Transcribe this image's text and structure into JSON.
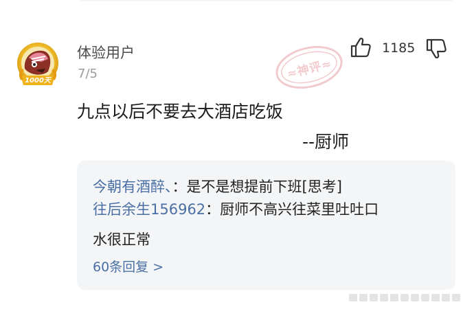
{
  "comment": {
    "username": "体验用户",
    "date": "7/5",
    "badge_text": "1000天",
    "stamp_text": "≈神评≈",
    "like_count": "1185",
    "body": "九点以后不要去大酒店吃饭",
    "signature": "--厨师",
    "icons": {
      "avatar": "avatar-1000-days-badge",
      "like": "thumbs-up-icon",
      "dislike": "thumbs-down-icon"
    }
  },
  "replies": {
    "items": [
      {
        "name": "今朝有酒醉、",
        "sep": "：",
        "text": "是不是想提前下班[思考]"
      },
      {
        "name": "往后余生156962",
        "sep": "：",
        "text_line1": "厨师不高兴往菜里吐吐口",
        "text_line2": "水很正常"
      }
    ],
    "more": "60条回复 >"
  },
  "colors": {
    "background": "#ffffff",
    "reply_panel": "#f4f5f7",
    "link_blue": "#4a6fa5",
    "stamp_pink": "#e6a0a6"
  }
}
